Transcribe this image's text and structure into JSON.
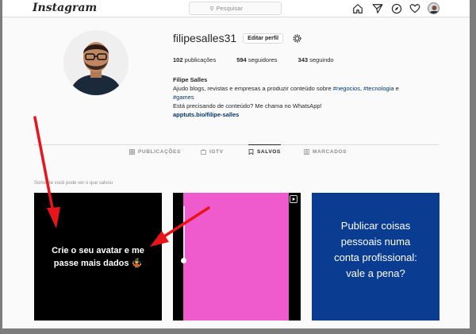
{
  "nav": {
    "logo": "Instagram",
    "search_placeholder": "Pesquisar",
    "icons": [
      "home-icon",
      "direct-icon",
      "explore-icon",
      "activity-icon",
      "profile-avatar"
    ]
  },
  "profile": {
    "username": "filipesalles31",
    "edit_label": "Editar perfil",
    "stats": [
      {
        "count": "102",
        "label": "publicações"
      },
      {
        "count": "594",
        "label": "seguidores"
      },
      {
        "count": "343",
        "label": "seguindo"
      }
    ],
    "bio": {
      "name": "Filipe Salles",
      "line1_prefix": "Ajudo blogs, revistas e empresas a produzir conteúdo sobre ",
      "tag1": "#negocios",
      "sep1": ", ",
      "tag2": "#tecnologia",
      "sep2": " e",
      "tag3": "#games",
      "line3": "Está precisando de conteúdo? Me chama no WhatsApp!",
      "link": "apptuts.bio/filipe-salles"
    }
  },
  "tabs": [
    {
      "label": "PUBLICAÇÕES",
      "icon": "grid-icon",
      "active": false
    },
    {
      "label": "IGTV",
      "icon": "igtv-icon",
      "active": false
    },
    {
      "label": "SALVOS",
      "icon": "bookmark-icon",
      "active": true
    },
    {
      "label": "MARCADOS",
      "icon": "tagged-icon",
      "active": false
    }
  ],
  "saved_notice": "Somente você pode ver o que salvou",
  "posts": [
    {
      "text_line1": "Crie o seu avatar e me",
      "text_line2": "passe mais dados 🤹"
    },
    {
      "type": "reel"
    },
    {
      "text_line1": "Publicar coisas",
      "text_line2": "pessoais numa",
      "text_line3": "conta profissional:",
      "text_line4": "vale a pena?"
    }
  ],
  "colors": {
    "annotation_arrow": "#e8141c",
    "post3_bg": "#0a3d91",
    "post2_pink": "#ef5bcc",
    "link": "#00376b"
  }
}
